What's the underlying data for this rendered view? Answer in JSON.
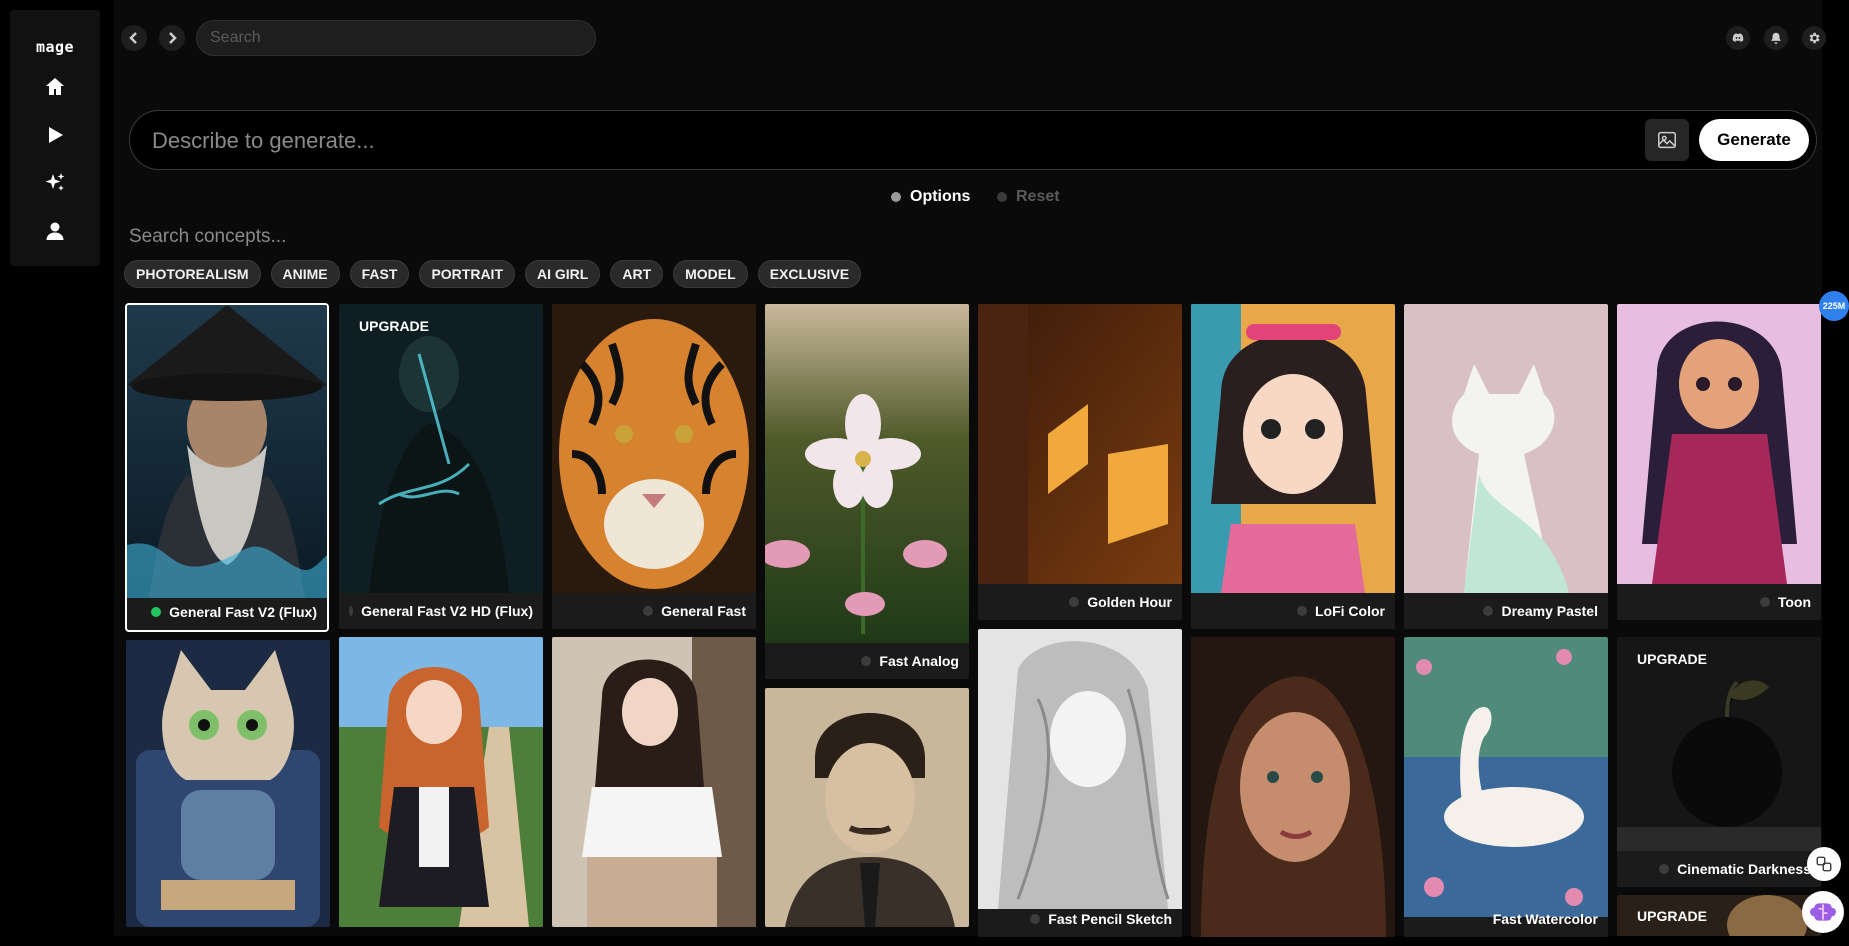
{
  "sidebar": {
    "logo": "mage",
    "items": [
      {
        "name": "home",
        "icon": "home-icon"
      },
      {
        "name": "play",
        "icon": "play-icon"
      },
      {
        "name": "sparkles",
        "icon": "sparkles-icon"
      },
      {
        "name": "profile",
        "icon": "user-icon"
      }
    ]
  },
  "header": {
    "search_placeholder": "Search",
    "icons": [
      "discord-icon",
      "bell-icon",
      "gear-icon"
    ]
  },
  "prompt": {
    "placeholder": "Describe to generate...",
    "generate_label": "Generate"
  },
  "options": {
    "options_label": "Options",
    "reset_label": "Reset"
  },
  "concepts": {
    "placeholder": "Search concepts...",
    "tags": [
      "PHOTOREALISM",
      "ANIME",
      "FAST",
      "PORTRAIT",
      "AI GIRL",
      "ART",
      "MODEL",
      "EXCLUSIVE"
    ]
  },
  "models": [
    {
      "label": "General Fast V2 (Flux)",
      "active": true,
      "upgrade": ""
    },
    {
      "label": "General Fast V2 HD (Flux)",
      "active": false,
      "upgrade": "UPGRADE"
    },
    {
      "label": "General Fast",
      "active": false,
      "upgrade": ""
    },
    {
      "label": "Fast Analog",
      "active": false,
      "upgrade": ""
    },
    {
      "label": "Golden Hour",
      "active": false,
      "upgrade": ""
    },
    {
      "label": "LoFi Color",
      "active": false,
      "upgrade": ""
    },
    {
      "label": "Dreamy Pastel",
      "active": false,
      "upgrade": ""
    },
    {
      "label": "Toon",
      "active": false,
      "upgrade": ""
    },
    {
      "label": "Fast Pencil Sketch",
      "active": false,
      "upgrade": ""
    },
    {
      "label": "Fast Watercolor",
      "active": false,
      "upgrade": ""
    },
    {
      "label": "Cinematic Darkness",
      "active": false,
      "upgrade": "UPGRADE"
    },
    {
      "label": "",
      "active": false,
      "upgrade": "UPGRADE"
    }
  ],
  "usage_badge": "225M",
  "colors": {
    "active_dot": "#22c55e",
    "inactive_dot": "#3c3c3c",
    "badge": "#2f80ed"
  }
}
